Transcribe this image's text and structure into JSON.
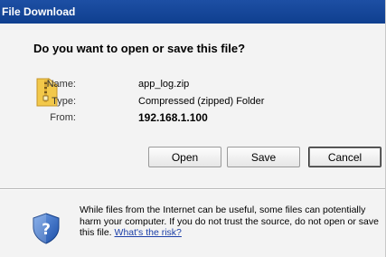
{
  "dialog": {
    "title": "File Download",
    "question": "Do you want to open or save this file?"
  },
  "file": {
    "icon": "zip-folder-icon",
    "name_label": "Name:",
    "name_value": "app_log.zip",
    "type_label": "Type:",
    "type_value": "Compressed (zipped) Folder",
    "from_label": "From:",
    "from_value": "192.168.1.100"
  },
  "buttons": {
    "open": "Open",
    "save": "Save",
    "cancel": "Cancel"
  },
  "warning": {
    "icon": "question-shield-icon",
    "text": "While files from the Internet can be useful, some files can potentially harm your computer. If you do not trust the source, do not open or save this file.",
    "link_text": "What's the risk?"
  },
  "colors": {
    "titlebar": "#1d4fa4",
    "link": "#1c3fa8",
    "background": "#f3f3f3"
  }
}
